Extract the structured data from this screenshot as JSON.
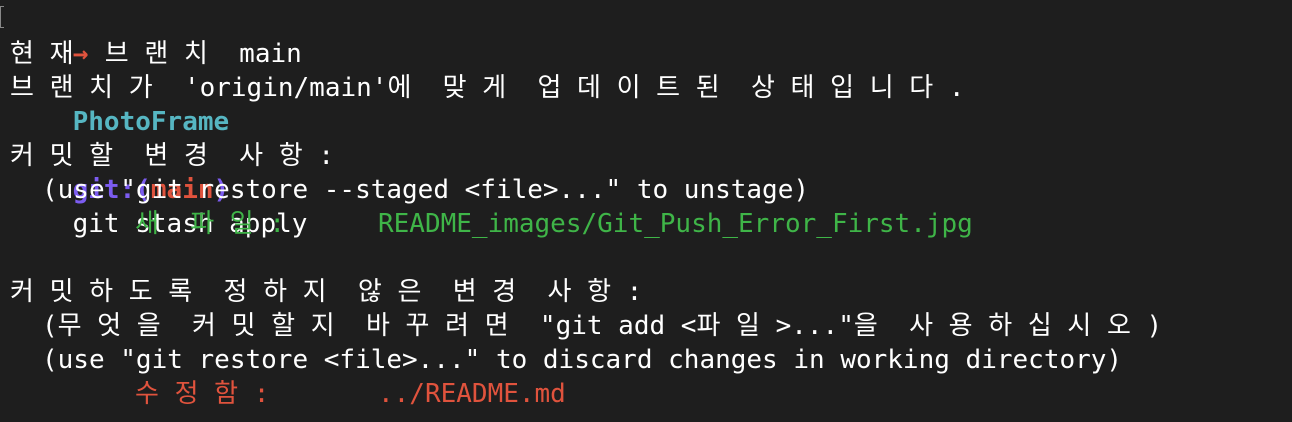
{
  "colors": {
    "background": "#1e1e1e",
    "text": "#ffffff",
    "arrow": "#e0533d",
    "dir": "#56b6c2",
    "git_label": "#7c5cf0",
    "branch": "#e0533d",
    "new_file": "#3fb548",
    "modified": "#e0533d"
  },
  "prompt": {
    "arrow": "→",
    "dir": "PhotoFrame",
    "git_label": "git:(",
    "branch": "main",
    "git_close": ")",
    "command": "git stash apply"
  },
  "status": {
    "current_branch": "현 재  브 랜 치  main",
    "up_to_date": "브 랜 치 가  'origin/main'에  맞 게  업 데 이 트 된  상 태 입 니 다 .",
    "staged_header": "커 밋 할  변 경  사 항 :",
    "staged_hint": "(use \"git restore --staged <file>...\" to unstage)",
    "staged_kind": "새  파 일 :",
    "staged_file": "README_images/Git_Push_Error_First.jpg",
    "unstaged_header": "커 밋 하 도 록  정 하 지  않 은  변 경  사 항 :",
    "unstaged_hint_1": "(무 엇 을  커 밋 할 지  바 꾸 려 면  \"git add <파 일 >...\"을  사 용 하 십 시 오 )",
    "unstaged_hint_2": "(use \"git restore <file>...\" to discard changes in working directory)",
    "unstaged_kind": "수 정 함 :",
    "unstaged_file": "../README.md"
  }
}
